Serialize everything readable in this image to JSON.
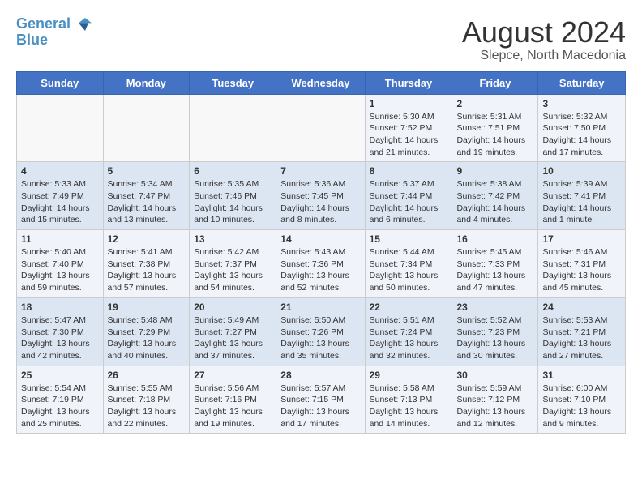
{
  "logo": {
    "line1": "General",
    "line2": "Blue"
  },
  "title": {
    "month_year": "August 2024",
    "location": "Slepce, North Macedonia"
  },
  "days_of_week": [
    "Sunday",
    "Monday",
    "Tuesday",
    "Wednesday",
    "Thursday",
    "Friday",
    "Saturday"
  ],
  "weeks": [
    [
      {
        "day": "",
        "info": ""
      },
      {
        "day": "",
        "info": ""
      },
      {
        "day": "",
        "info": ""
      },
      {
        "day": "",
        "info": ""
      },
      {
        "day": "1",
        "info": "Sunrise: 5:30 AM\nSunset: 7:52 PM\nDaylight: 14 hours\nand 21 minutes."
      },
      {
        "day": "2",
        "info": "Sunrise: 5:31 AM\nSunset: 7:51 PM\nDaylight: 14 hours\nand 19 minutes."
      },
      {
        "day": "3",
        "info": "Sunrise: 5:32 AM\nSunset: 7:50 PM\nDaylight: 14 hours\nand 17 minutes."
      }
    ],
    [
      {
        "day": "4",
        "info": "Sunrise: 5:33 AM\nSunset: 7:49 PM\nDaylight: 14 hours\nand 15 minutes."
      },
      {
        "day": "5",
        "info": "Sunrise: 5:34 AM\nSunset: 7:47 PM\nDaylight: 14 hours\nand 13 minutes."
      },
      {
        "day": "6",
        "info": "Sunrise: 5:35 AM\nSunset: 7:46 PM\nDaylight: 14 hours\nand 10 minutes."
      },
      {
        "day": "7",
        "info": "Sunrise: 5:36 AM\nSunset: 7:45 PM\nDaylight: 14 hours\nand 8 minutes."
      },
      {
        "day": "8",
        "info": "Sunrise: 5:37 AM\nSunset: 7:44 PM\nDaylight: 14 hours\nand 6 minutes."
      },
      {
        "day": "9",
        "info": "Sunrise: 5:38 AM\nSunset: 7:42 PM\nDaylight: 14 hours\nand 4 minutes."
      },
      {
        "day": "10",
        "info": "Sunrise: 5:39 AM\nSunset: 7:41 PM\nDaylight: 14 hours\nand 1 minute."
      }
    ],
    [
      {
        "day": "11",
        "info": "Sunrise: 5:40 AM\nSunset: 7:40 PM\nDaylight: 13 hours\nand 59 minutes."
      },
      {
        "day": "12",
        "info": "Sunrise: 5:41 AM\nSunset: 7:38 PM\nDaylight: 13 hours\nand 57 minutes."
      },
      {
        "day": "13",
        "info": "Sunrise: 5:42 AM\nSunset: 7:37 PM\nDaylight: 13 hours\nand 54 minutes."
      },
      {
        "day": "14",
        "info": "Sunrise: 5:43 AM\nSunset: 7:36 PM\nDaylight: 13 hours\nand 52 minutes."
      },
      {
        "day": "15",
        "info": "Sunrise: 5:44 AM\nSunset: 7:34 PM\nDaylight: 13 hours\nand 50 minutes."
      },
      {
        "day": "16",
        "info": "Sunrise: 5:45 AM\nSunset: 7:33 PM\nDaylight: 13 hours\nand 47 minutes."
      },
      {
        "day": "17",
        "info": "Sunrise: 5:46 AM\nSunset: 7:31 PM\nDaylight: 13 hours\nand 45 minutes."
      }
    ],
    [
      {
        "day": "18",
        "info": "Sunrise: 5:47 AM\nSunset: 7:30 PM\nDaylight: 13 hours\nand 42 minutes."
      },
      {
        "day": "19",
        "info": "Sunrise: 5:48 AM\nSunset: 7:29 PM\nDaylight: 13 hours\nand 40 minutes."
      },
      {
        "day": "20",
        "info": "Sunrise: 5:49 AM\nSunset: 7:27 PM\nDaylight: 13 hours\nand 37 minutes."
      },
      {
        "day": "21",
        "info": "Sunrise: 5:50 AM\nSunset: 7:26 PM\nDaylight: 13 hours\nand 35 minutes."
      },
      {
        "day": "22",
        "info": "Sunrise: 5:51 AM\nSunset: 7:24 PM\nDaylight: 13 hours\nand 32 minutes."
      },
      {
        "day": "23",
        "info": "Sunrise: 5:52 AM\nSunset: 7:23 PM\nDaylight: 13 hours\nand 30 minutes."
      },
      {
        "day": "24",
        "info": "Sunrise: 5:53 AM\nSunset: 7:21 PM\nDaylight: 13 hours\nand 27 minutes."
      }
    ],
    [
      {
        "day": "25",
        "info": "Sunrise: 5:54 AM\nSunset: 7:19 PM\nDaylight: 13 hours\nand 25 minutes."
      },
      {
        "day": "26",
        "info": "Sunrise: 5:55 AM\nSunset: 7:18 PM\nDaylight: 13 hours\nand 22 minutes."
      },
      {
        "day": "27",
        "info": "Sunrise: 5:56 AM\nSunset: 7:16 PM\nDaylight: 13 hours\nand 19 minutes."
      },
      {
        "day": "28",
        "info": "Sunrise: 5:57 AM\nSunset: 7:15 PM\nDaylight: 13 hours\nand 17 minutes."
      },
      {
        "day": "29",
        "info": "Sunrise: 5:58 AM\nSunset: 7:13 PM\nDaylight: 13 hours\nand 14 minutes."
      },
      {
        "day": "30",
        "info": "Sunrise: 5:59 AM\nSunset: 7:12 PM\nDaylight: 13 hours\nand 12 minutes."
      },
      {
        "day": "31",
        "info": "Sunrise: 6:00 AM\nSunset: 7:10 PM\nDaylight: 13 hours\nand 9 minutes."
      }
    ]
  ]
}
